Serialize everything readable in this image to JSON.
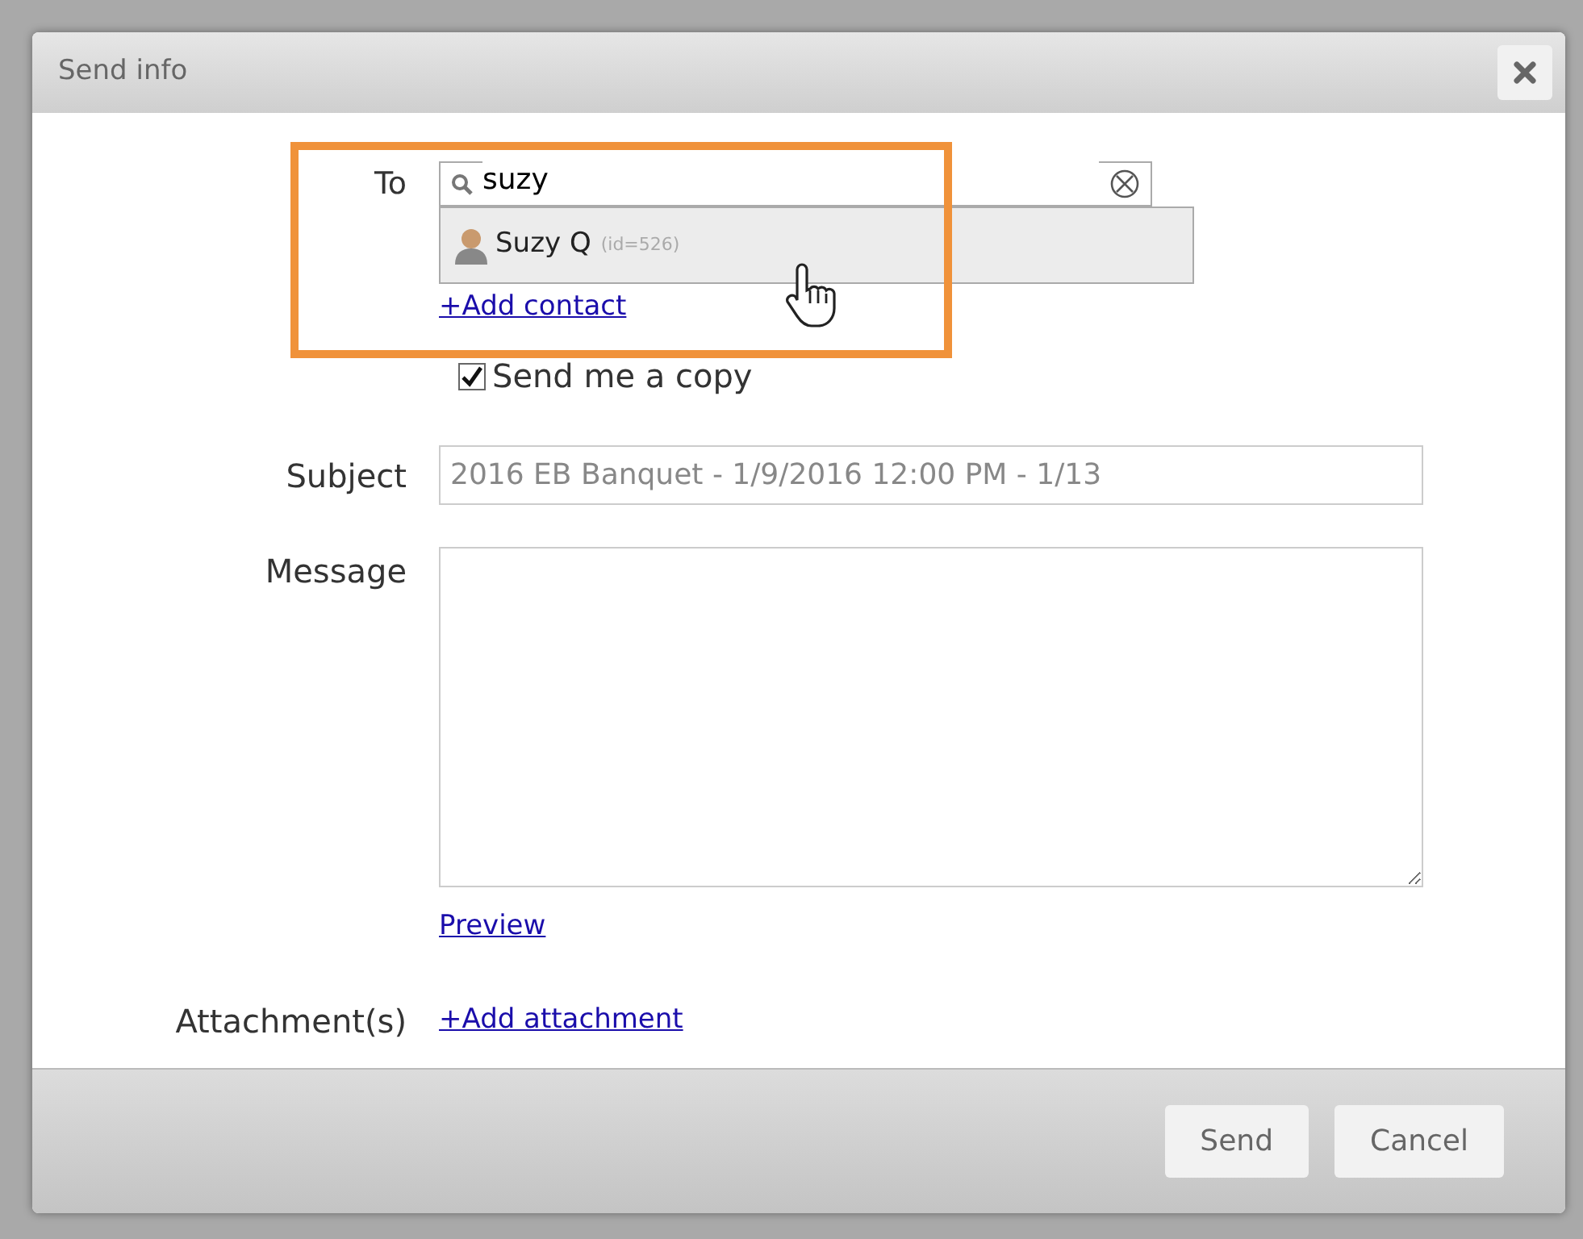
{
  "dialog": {
    "title": "Send info"
  },
  "to": {
    "label": "To",
    "value": "suzy",
    "suggestions": [
      {
        "name": "Suzy Q",
        "note": "(id=526)",
        "selected": true
      }
    ],
    "add_link": "+Add contact"
  },
  "copy": {
    "label": "Send me a copy",
    "checked": true
  },
  "subject": {
    "label": "Subject",
    "value": "2016 EB Banquet - 1/9/2016 12:00 PM - 1/13",
    "disabled": true
  },
  "message": {
    "label": "Message",
    "preview_link": "Preview"
  },
  "attachment": {
    "label": "Attachment(s)",
    "link": "+Add attachment"
  },
  "buttons": [
    "Send",
    "Cancel"
  ]
}
